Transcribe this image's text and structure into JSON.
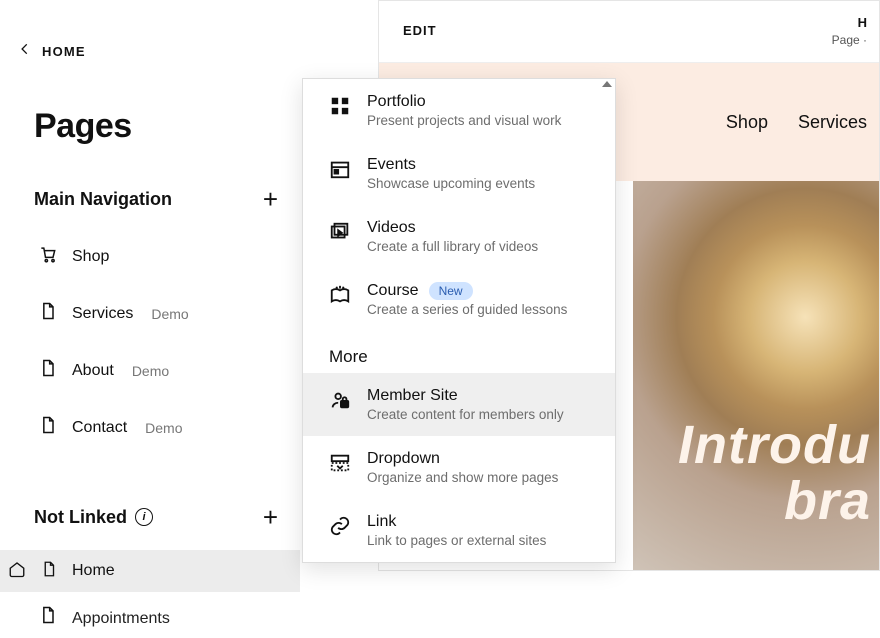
{
  "back_label": "HOME",
  "pages_title": "Pages",
  "sections": {
    "main": {
      "title": "Main Navigation",
      "items": [
        {
          "label": "Shop",
          "demo": ""
        },
        {
          "label": "Services",
          "demo": "Demo"
        },
        {
          "label": "About",
          "demo": "Demo"
        },
        {
          "label": "Contact",
          "demo": "Demo"
        }
      ]
    },
    "not_linked": {
      "title": "Not Linked",
      "items": [
        {
          "label": "Home"
        },
        {
          "label": "Appointments"
        }
      ]
    }
  },
  "preview": {
    "edit": "EDIT",
    "title_partial": "H",
    "subtitle_partial": "Page · ",
    "nav": {
      "shop": "Shop",
      "services": "Services"
    },
    "hero_line1": "Introdu",
    "hero_line2": "bra"
  },
  "popover": {
    "items": [
      {
        "title": "Portfolio",
        "desc": "Present projects and visual work"
      },
      {
        "title": "Events",
        "desc": "Showcase upcoming events"
      },
      {
        "title": "Videos",
        "desc": "Create a full library of videos"
      },
      {
        "title": "Course",
        "desc": "Create a series of guided lessons",
        "badge": "New"
      }
    ],
    "more_label": "More",
    "more_items": [
      {
        "title": "Member Site",
        "desc": "Create content for members only",
        "selected": true
      },
      {
        "title": "Dropdown",
        "desc": "Organize and show more pages"
      },
      {
        "title": "Link",
        "desc": "Link to pages or external sites"
      }
    ]
  }
}
